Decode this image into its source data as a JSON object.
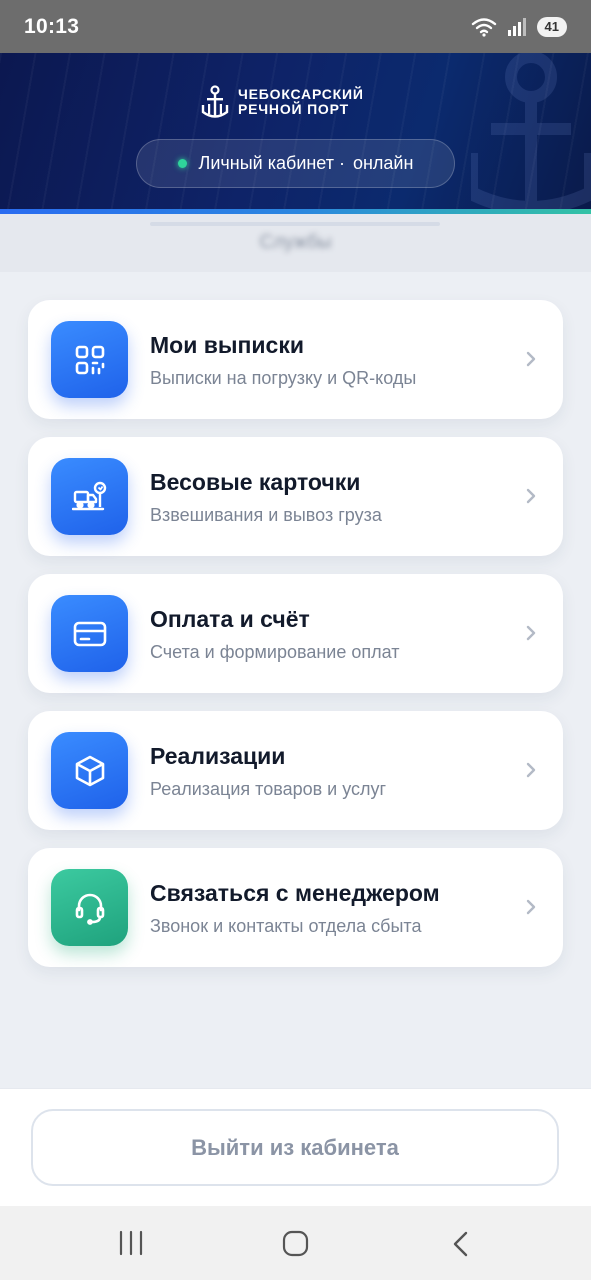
{
  "status_bar": {
    "time": "10:13",
    "battery": "41",
    "icons": [
      "wifi-icon",
      "signal-icon",
      "battery-icon"
    ]
  },
  "header": {
    "logo_line1": "ЧЕБОКСАРСКИЙ",
    "logo_line2": "РЕЧНОЙ ПОРТ",
    "cabinet_label": "Личный кабинет ·",
    "status_label": "онлайн",
    "status_color": "#2fd39b"
  },
  "section": {
    "title": "Службы"
  },
  "menu": [
    {
      "title": "Мои выписки",
      "subtitle": "Выписки на погрузку и QR-коды",
      "icon": "qr-code-icon",
      "color": "#2a72f5"
    },
    {
      "title": "Весовые карточки",
      "subtitle": "Взвешивания и вывоз груза",
      "icon": "truck-scale-icon",
      "color": "#2a72f5"
    },
    {
      "title": "Оплата и счёт",
      "subtitle": "Счета и формирование оплат",
      "icon": "credit-card-icon",
      "color": "#2a72f5"
    },
    {
      "title": "Реализации",
      "subtitle": "Реализация товаров и услуг",
      "icon": "box-icon",
      "color": "#2a72f5"
    },
    {
      "title": "Связаться с менеджером",
      "subtitle": "Звонок и контакты отдела сбыта",
      "icon": "headset-icon",
      "color": "#27b88f"
    }
  ],
  "logout": {
    "label": "Выйти из кабинета"
  },
  "nav_bar": {
    "buttons": [
      "recents-icon",
      "home-icon",
      "back-icon"
    ]
  }
}
